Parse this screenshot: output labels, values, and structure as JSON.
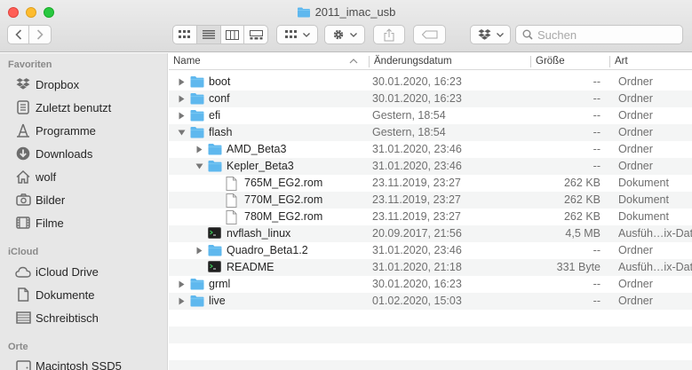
{
  "window": {
    "title": "2011_imac_usb"
  },
  "toolbar": {
    "search_placeholder": "Suchen",
    "icons": [
      "back-icon",
      "forward-icon",
      "icon-view-icon",
      "list-view-icon",
      "column-view-icon",
      "gallery-view-icon",
      "group-icon",
      "gear-icon",
      "share-icon",
      "tag-icon",
      "dropbox-icon",
      "search-icon"
    ]
  },
  "sidebar": {
    "favorites_header": "Favoriten",
    "favorites": [
      {
        "label": "Dropbox",
        "icon": "dropbox-icon"
      },
      {
        "label": "Zuletzt benutzt",
        "icon": "recents-icon"
      },
      {
        "label": "Programme",
        "icon": "applications-icon"
      },
      {
        "label": "Downloads",
        "icon": "downloads-icon"
      },
      {
        "label": "wolf",
        "icon": "home-icon"
      },
      {
        "label": "Bilder",
        "icon": "camera-icon"
      },
      {
        "label": "Filme",
        "icon": "film-icon"
      }
    ],
    "icloud_header": "iCloud",
    "icloud": [
      {
        "label": "iCloud Drive",
        "icon": "cloud-icon"
      },
      {
        "label": "Dokumente",
        "icon": "document-icon"
      },
      {
        "label": "Schreibtisch",
        "icon": "desktop-icon"
      }
    ],
    "other_header": "Orte",
    "other": [
      {
        "label": "Macintosh SSD5",
        "icon": "disk-icon"
      }
    ]
  },
  "columns": {
    "name": "Name",
    "date": "Änderungsdatum",
    "size": "Größe",
    "kind": "Art"
  },
  "rows": [
    {
      "name": "boot",
      "date": "30.01.2020, 16:23",
      "size": "--",
      "kind": "Ordner",
      "level": 0,
      "type": "folder",
      "expand": "collapsed"
    },
    {
      "name": "conf",
      "date": "30.01.2020, 16:23",
      "size": "--",
      "kind": "Ordner",
      "level": 0,
      "type": "folder",
      "expand": "collapsed"
    },
    {
      "name": "efi",
      "date": "Gestern, 18:54",
      "size": "--",
      "kind": "Ordner",
      "level": 0,
      "type": "folder",
      "expand": "collapsed"
    },
    {
      "name": "flash",
      "date": "Gestern, 18:54",
      "size": "--",
      "kind": "Ordner",
      "level": 0,
      "type": "folder",
      "expand": "expanded"
    },
    {
      "name": "AMD_Beta3",
      "date": "31.01.2020, 23:46",
      "size": "--",
      "kind": "Ordner",
      "level": 1,
      "type": "folder",
      "expand": "collapsed"
    },
    {
      "name": "Kepler_Beta3",
      "date": "31.01.2020, 23:46",
      "size": "--",
      "kind": "Ordner",
      "level": 1,
      "type": "folder",
      "expand": "expanded"
    },
    {
      "name": "765M_EG2.rom",
      "date": "23.11.2019, 23:27",
      "size": "262 KB",
      "kind": "Dokument",
      "level": 2,
      "type": "document",
      "expand": "none"
    },
    {
      "name": "770M_EG2.rom",
      "date": "23.11.2019, 23:27",
      "size": "262 KB",
      "kind": "Dokument",
      "level": 2,
      "type": "document",
      "expand": "none"
    },
    {
      "name": "780M_EG2.rom",
      "date": "23.11.2019, 23:27",
      "size": "262 KB",
      "kind": "Dokument",
      "level": 2,
      "type": "document",
      "expand": "none"
    },
    {
      "name": "nvflash_linux",
      "date": "20.09.2017, 21:56",
      "size": "4,5 MB",
      "kind": "Ausfüh…ix-Datei",
      "level": 1,
      "type": "executable",
      "expand": "none"
    },
    {
      "name": "Quadro_Beta1.2",
      "date": "31.01.2020, 23:46",
      "size": "--",
      "kind": "Ordner",
      "level": 1,
      "type": "folder",
      "expand": "collapsed"
    },
    {
      "name": "README",
      "date": "31.01.2020, 21:18",
      "size": "331 Byte",
      "kind": "Ausfüh…ix-Datei",
      "level": 1,
      "type": "executable",
      "expand": "none"
    },
    {
      "name": "grml",
      "date": "30.01.2020, 16:23",
      "size": "--",
      "kind": "Ordner",
      "level": 0,
      "type": "folder",
      "expand": "collapsed"
    },
    {
      "name": "live",
      "date": "01.02.2020, 15:03",
      "size": "--",
      "kind": "Ordner",
      "level": 0,
      "type": "folder",
      "expand": "collapsed"
    }
  ],
  "colors": {
    "folder": "#5fb8ee",
    "folder_tab": "#79c7f3",
    "accent": "#1e7cf5"
  }
}
